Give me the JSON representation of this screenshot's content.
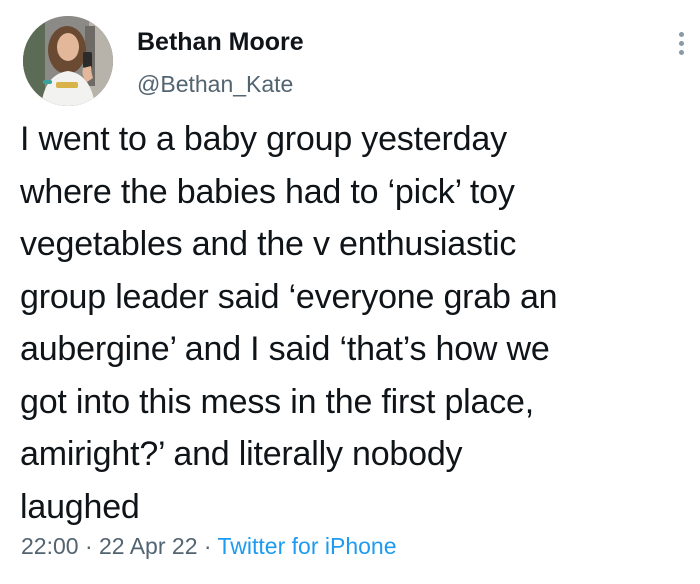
{
  "tweet": {
    "author": {
      "display_name": "Bethan Moore",
      "handle": "@Bethan_Kate"
    },
    "text": "I went to a baby group yesterday\nwhere the babies had to ‘pick’ toy\nvegetables and the v enthusiastic\ngroup leader said ‘everyone grab an\naubergine’ and I said ‘that’s how we\ngot into this mess in the first place,\namiright?’ and literally nobody\nlaughed",
    "time": "22:00",
    "separator": " · ",
    "date": "22 Apr 22",
    "source": "Twitter for iPhone"
  },
  "icons": {
    "more": "more-options-icon",
    "avatar": "profile-photo"
  },
  "colors": {
    "text": "#0f1419",
    "secondary": "#536471",
    "link": "#1d9bf0"
  }
}
